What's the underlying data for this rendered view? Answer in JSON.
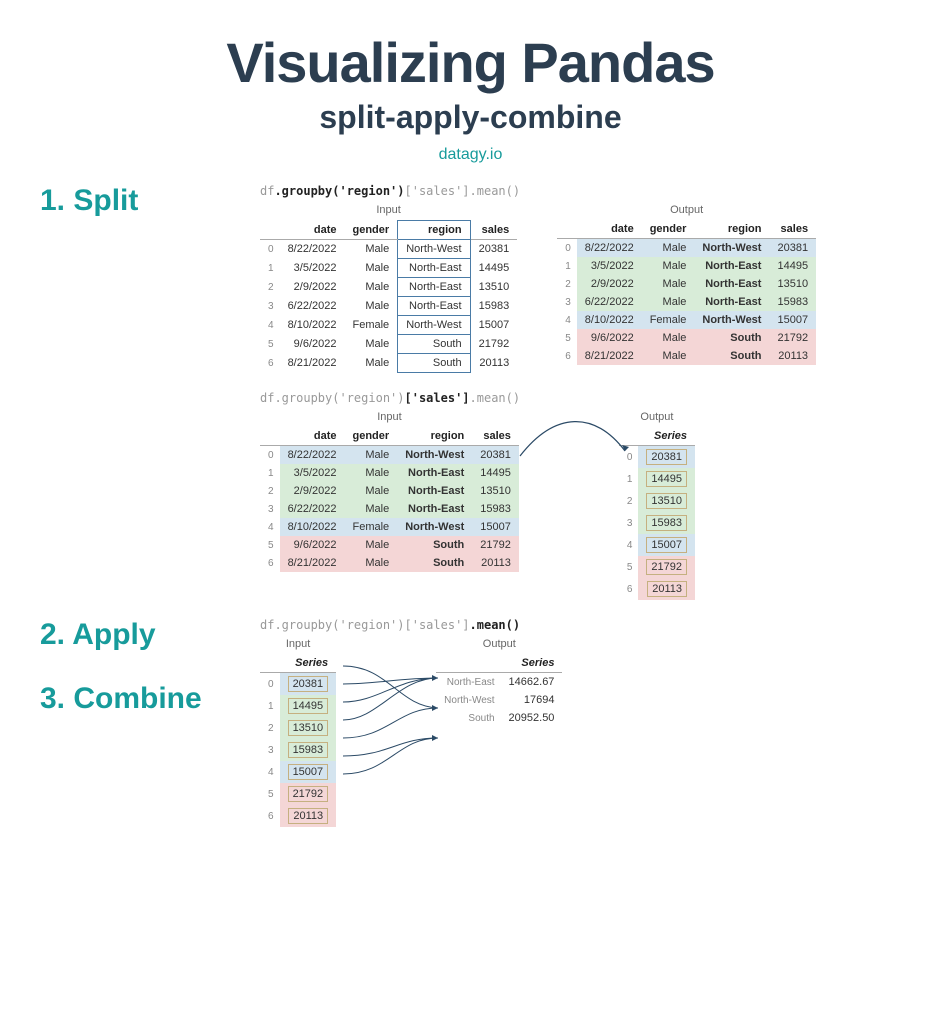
{
  "header": {
    "title": "Visualizing Pandas",
    "subtitle": "split-apply-combine",
    "source": "datagy.io"
  },
  "steps": {
    "split": "1. Split",
    "apply": "2. Apply",
    "combine": "3. Combine"
  },
  "code": {
    "pre": "df",
    "groupby": ".groupby('region')",
    "sales": "['sales']",
    "mean": ".mean()"
  },
  "labels": {
    "input": "Input",
    "output": "Output",
    "series": "Series"
  },
  "columns": {
    "date": "date",
    "gender": "gender",
    "region": "region",
    "sales": "sales"
  },
  "rows": [
    {
      "idx": "0",
      "date": "8/22/2022",
      "gender": "Male",
      "region": "North-West",
      "sales": "20381",
      "color": "blue"
    },
    {
      "idx": "1",
      "date": "3/5/2022",
      "gender": "Male",
      "region": "North-East",
      "sales": "14495",
      "color": "green"
    },
    {
      "idx": "2",
      "date": "2/9/2022",
      "gender": "Male",
      "region": "North-East",
      "sales": "13510",
      "color": "green"
    },
    {
      "idx": "3",
      "date": "6/22/2022",
      "gender": "Male",
      "region": "North-East",
      "sales": "15983",
      "color": "green"
    },
    {
      "idx": "4",
      "date": "8/10/2022",
      "gender": "Female",
      "region": "North-West",
      "sales": "15007",
      "color": "blue"
    },
    {
      "idx": "5",
      "date": "9/6/2022",
      "gender": "Male",
      "region": "South",
      "sales": "21792",
      "color": "pink"
    },
    {
      "idx": "6",
      "date": "8/21/2022",
      "gender": "Male",
      "region": "South",
      "sales": "20113",
      "color": "pink"
    }
  ],
  "result": [
    {
      "region": "North-East",
      "mean": "14662.67"
    },
    {
      "region": "North-West",
      "mean": "17694"
    },
    {
      "region": "South",
      "mean": "20952.50"
    }
  ]
}
